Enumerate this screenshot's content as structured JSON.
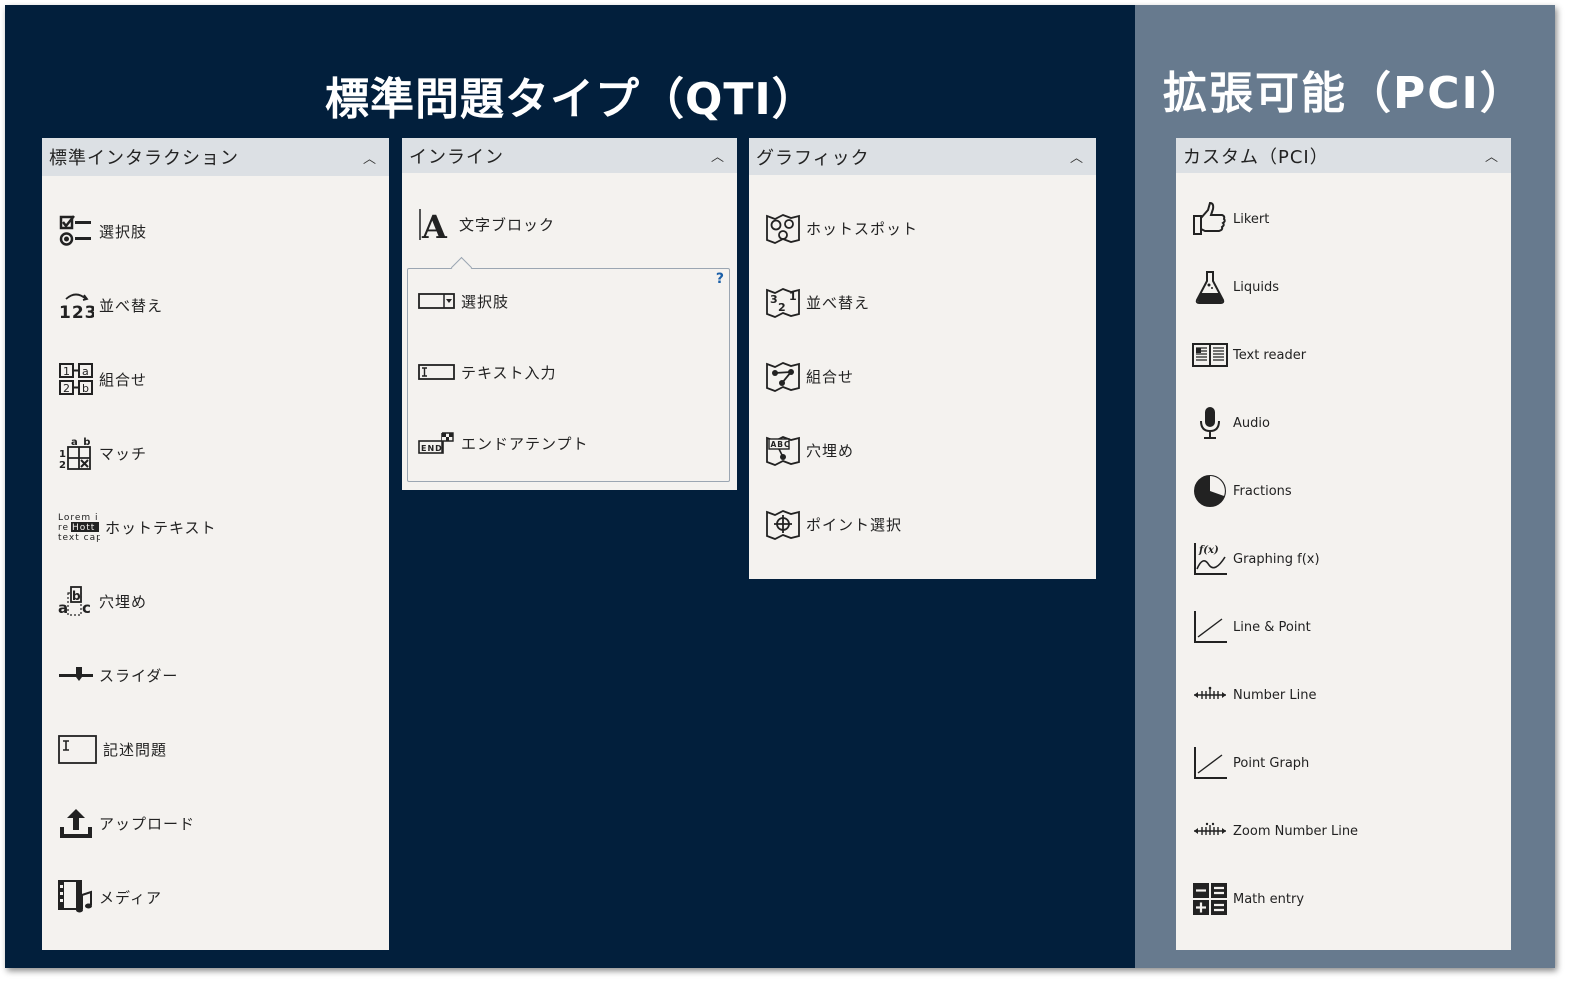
{
  "qti_title": "標準問題タイプ（QTI）",
  "pci_title": "拡張可能（PCI）",
  "panels": {
    "standard": {
      "header": "標準インタラクション",
      "items": [
        {
          "label": "選択肢",
          "icon": "choice-icon"
        },
        {
          "label": "並べ替え",
          "icon": "order-icon"
        },
        {
          "label": "組合せ",
          "icon": "associate-icon"
        },
        {
          "label": "マッチ",
          "icon": "match-icon"
        },
        {
          "label": "ホットテキスト",
          "icon": "hottext-icon"
        },
        {
          "label": "穴埋め",
          "icon": "gap-match-icon"
        },
        {
          "label": "スライダー",
          "icon": "slider-icon"
        },
        {
          "label": "記述問題",
          "icon": "extended-text-icon"
        },
        {
          "label": "アップロード",
          "icon": "upload-icon"
        },
        {
          "label": "メディア",
          "icon": "media-icon"
        }
      ],
      "hottext_icon_text": [
        "Lorem i",
        "re",
        "Hott",
        "text cap"
      ],
      "gap_icon_text": [
        "a",
        "b",
        "c"
      ],
      "match_icon_text": [
        "a b",
        "1",
        "2"
      ],
      "order_icon_text": "123",
      "associate_icon_text": [
        "1",
        "a",
        "2",
        "b"
      ]
    },
    "inline": {
      "header": "インライン",
      "block_item": {
        "label": "文字ブロック",
        "icon": "text-block-icon"
      },
      "help": "?",
      "sub_items": [
        {
          "label": "選択肢",
          "icon": "inline-choice-icon"
        },
        {
          "label": "テキスト入力",
          "icon": "text-entry-icon"
        },
        {
          "label": "エンドアテンプト",
          "icon": "end-attempt-icon"
        }
      ],
      "end_icon_text": "END",
      "text_block_glyph": "A"
    },
    "graphic": {
      "header": "グラフィック",
      "items": [
        {
          "label": "ホットスポット",
          "icon": "hotspot-icon"
        },
        {
          "label": "並べ替え",
          "icon": "graphic-order-icon"
        },
        {
          "label": "組合せ",
          "icon": "graphic-associate-icon"
        },
        {
          "label": "穴埋め",
          "icon": "graphic-gap-icon"
        },
        {
          "label": "ポイント選択",
          "icon": "select-point-icon"
        }
      ],
      "order_icon_text": [
        "3",
        "2",
        "1"
      ],
      "gap_icon_text": "ABC"
    },
    "custom": {
      "header": "カスタム（PCI）",
      "items": [
        {
          "label": "Likert",
          "icon": "thumbs-up-icon"
        },
        {
          "label": "Liquids",
          "icon": "flask-icon"
        },
        {
          "label": "Text reader",
          "icon": "book-icon"
        },
        {
          "label": "Audio",
          "icon": "microphone-icon"
        },
        {
          "label": "Fractions",
          "icon": "pie-icon"
        },
        {
          "label": "Graphing f(x)",
          "icon": "function-graph-icon"
        },
        {
          "label": "Line & Point",
          "icon": "line-point-icon"
        },
        {
          "label": "Number Line",
          "icon": "number-line-icon"
        },
        {
          "label": "Point Graph",
          "icon": "point-graph-icon"
        },
        {
          "label": "Zoom Number Line",
          "icon": "zoom-number-line-icon"
        },
        {
          "label": "Math entry",
          "icon": "math-entry-icon"
        }
      ],
      "graph_icon_text": "f(x)"
    }
  },
  "colors": {
    "qti_background": "#021f3c",
    "pci_background": "#677a8e",
    "panel_background": "#f4f2ef",
    "header_background": "#dce0e4",
    "help_color": "#1a5fa8"
  }
}
